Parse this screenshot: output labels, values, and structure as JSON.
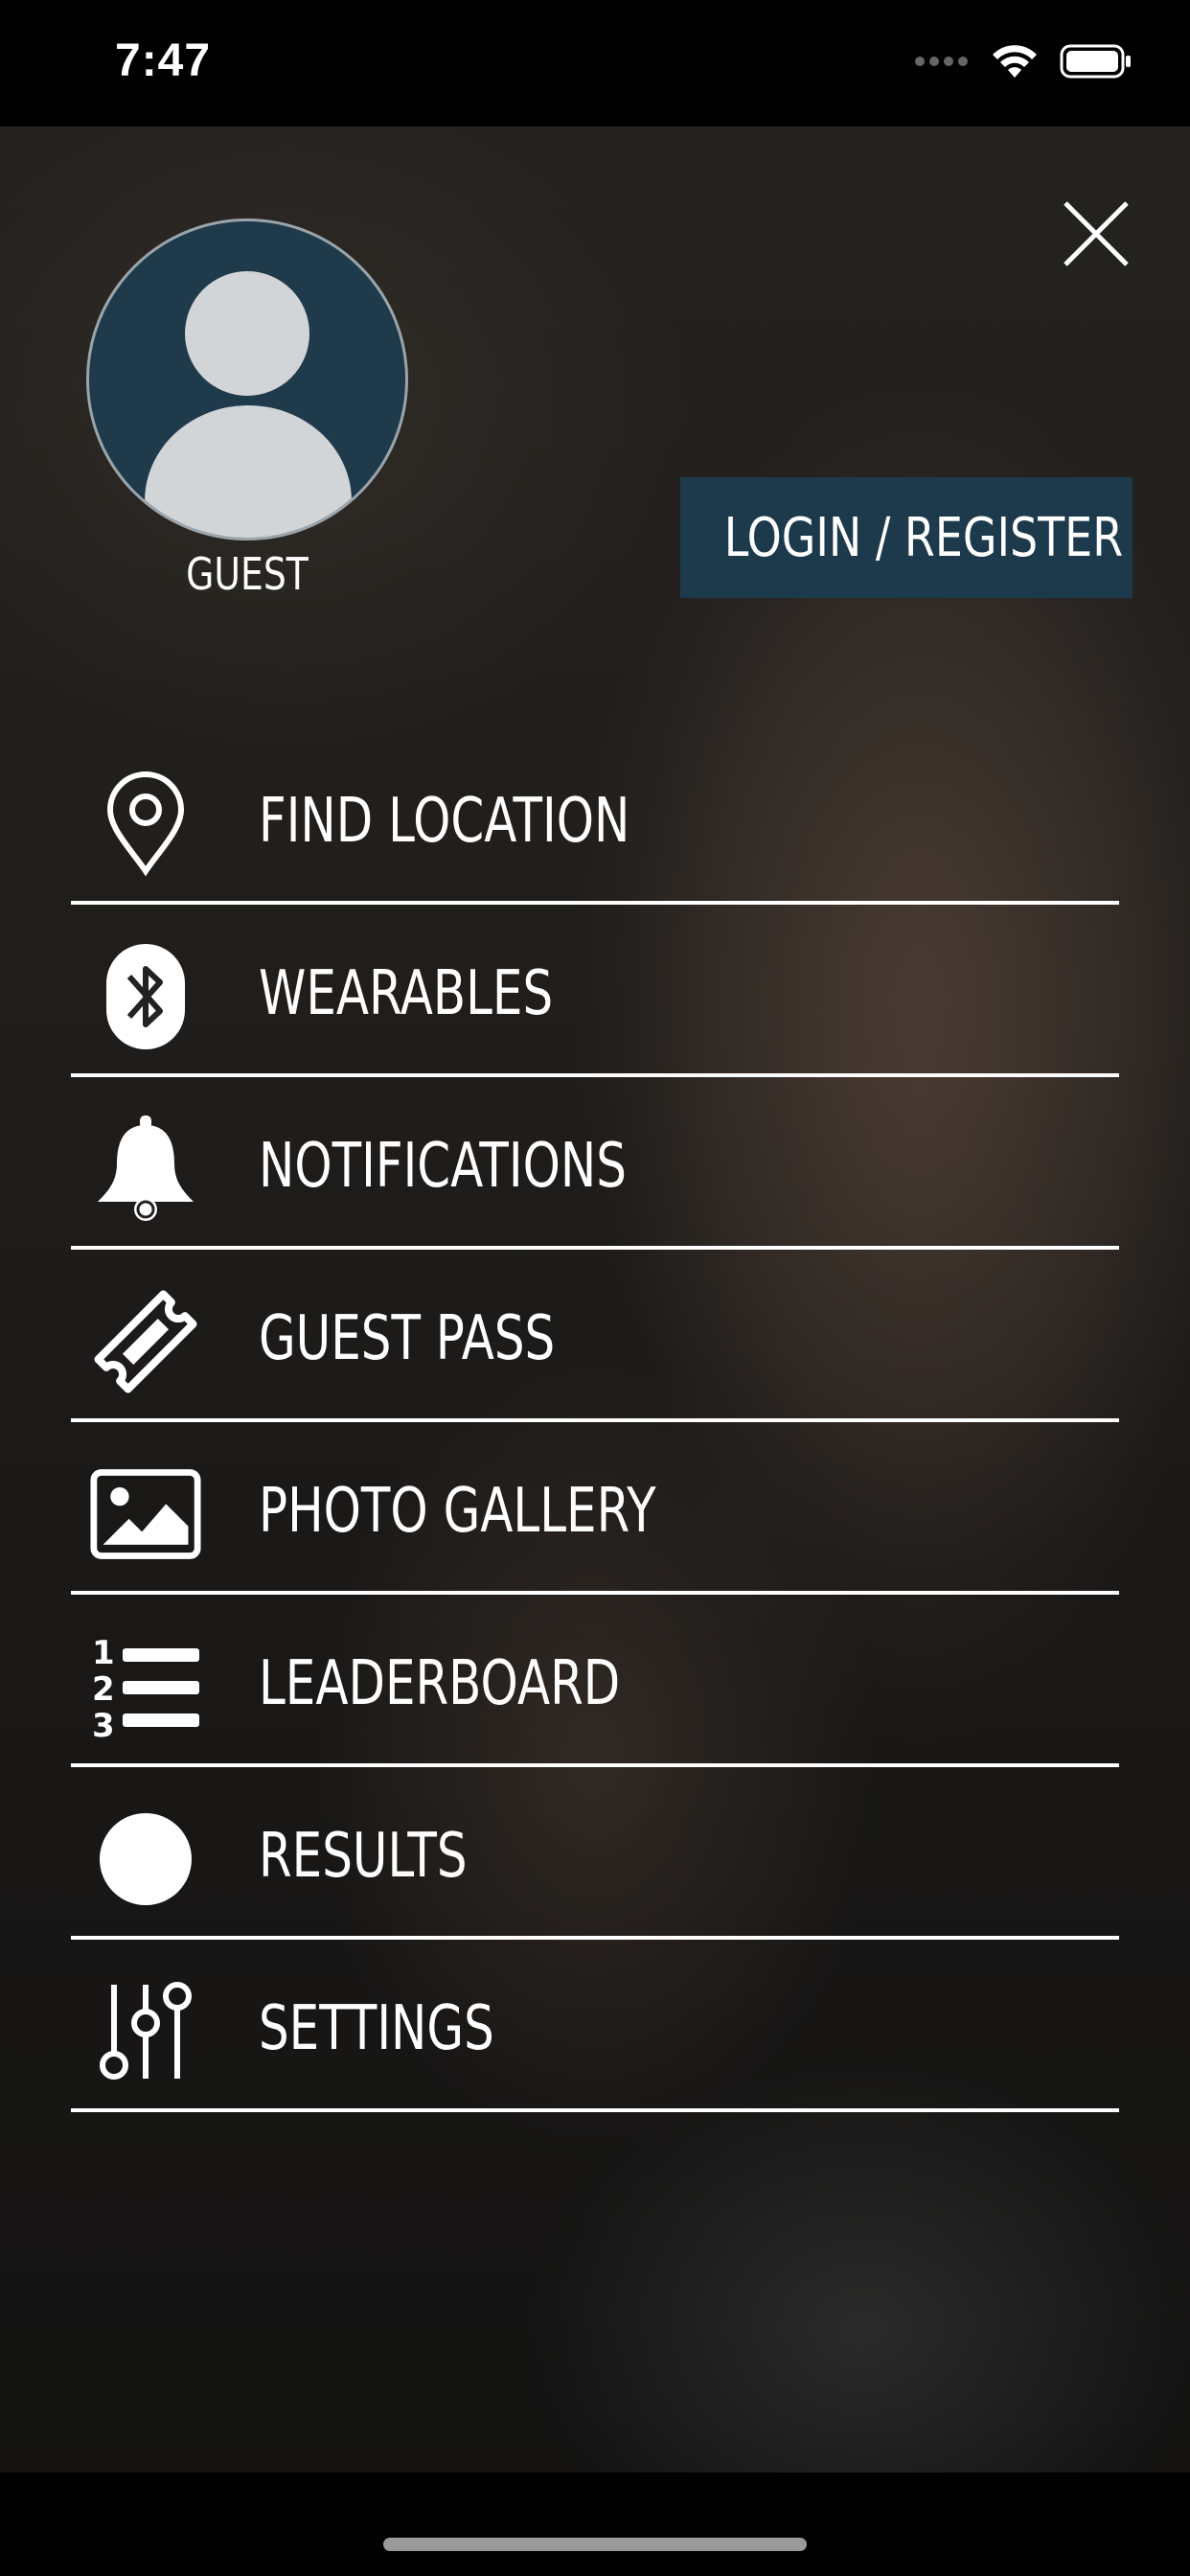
{
  "status_bar": {
    "time": "7:47",
    "icons": [
      "signal-dots-icon",
      "wifi-icon",
      "battery-icon"
    ]
  },
  "profile": {
    "avatar_icon": "user-avatar-icon",
    "name": "GUEST"
  },
  "login_button": {
    "label": "LOGIN / REGISTER"
  },
  "close_icon": "close-icon",
  "menu": {
    "items": [
      {
        "label": "FIND LOCATION",
        "icon": "map-pin-icon"
      },
      {
        "label": "WEARABLES",
        "icon": "bluetooth-icon"
      },
      {
        "label": "NOTIFICATIONS",
        "icon": "bell-icon"
      },
      {
        "label": "GUEST PASS",
        "icon": "ticket-icon"
      },
      {
        "label": "PHOTO GALLERY",
        "icon": "image-icon"
      },
      {
        "label": "LEADERBOARD",
        "icon": "numbered-list-icon"
      },
      {
        "label": "RESULTS",
        "icon": "circle-icon"
      },
      {
        "label": "SETTINGS",
        "icon": "sliders-icon"
      }
    ]
  },
  "colors": {
    "accent": "#1c3a4c",
    "avatar_bg": "#1f3a4b",
    "text": "#ffffff"
  }
}
